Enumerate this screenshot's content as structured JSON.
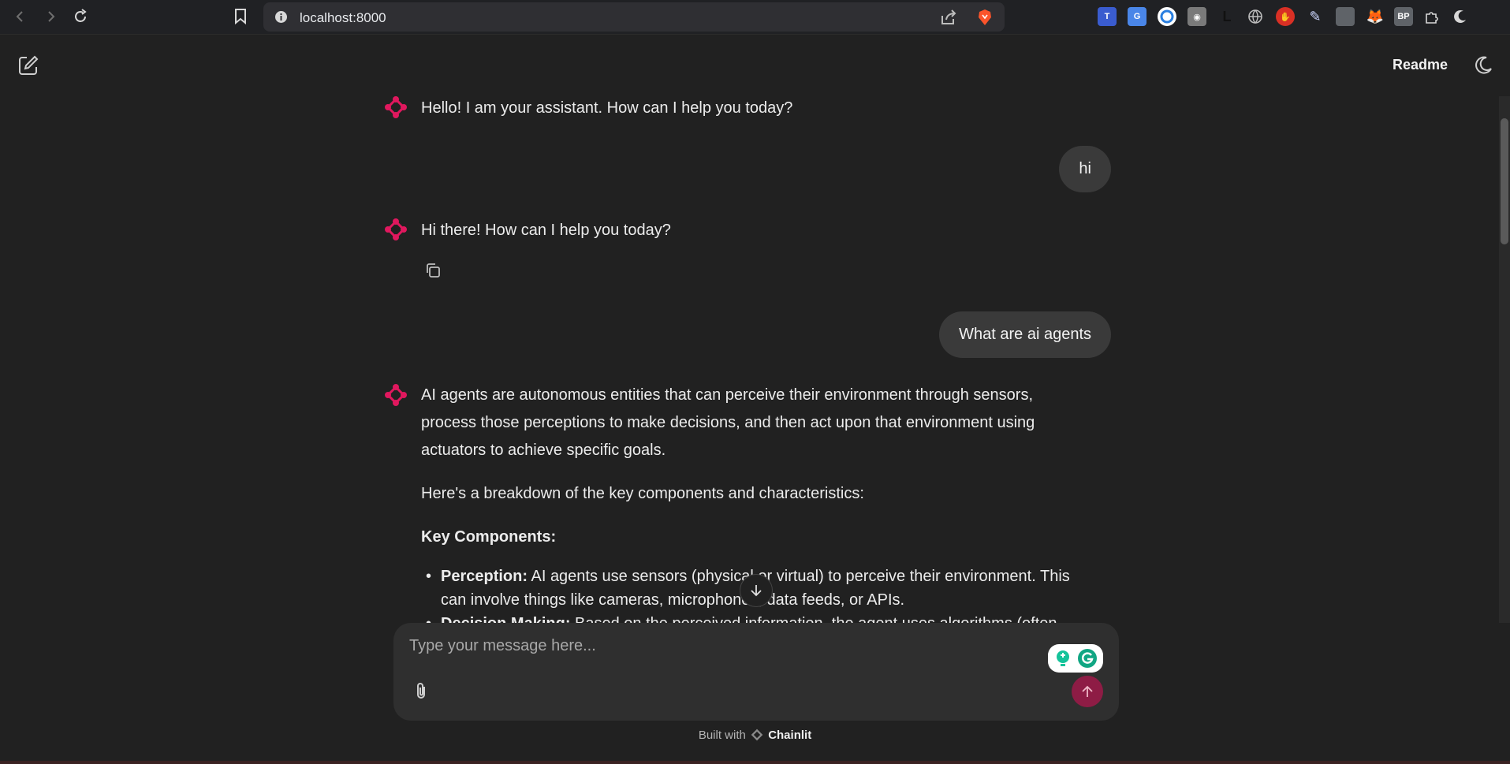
{
  "browser": {
    "url": "localhost:8000"
  },
  "header": {
    "readme_label": "Readme"
  },
  "messages": {
    "greeting": "Hello! I am your assistant. How can I help you today?",
    "user_1": "hi",
    "reply_1": "Hi there! How can I help you today?",
    "user_2": "What are ai agents",
    "reply_2_p1_l1": "AI agents are autonomous entities that can perceive their environment through sensors,",
    "reply_2_p1_l2": "process those perceptions to make decisions, and then act upon that environment using",
    "reply_2_p1_l3": "actuators to achieve specific goals.",
    "reply_2_p2": "Here's a breakdown of the key components and characteristics:",
    "reply_2_heading": "Key Components:",
    "bullet_1_term": "Perception:",
    "bullet_1_text": " AI agents use sensors (physical or virtual) to perceive their environment. This",
    "bullet_1_text_l2": "can involve things like cameras, microphones, data feeds, or APIs.",
    "bullet_2_term": "Decision Making:",
    "bullet_2_text": " Based on the perceived information, the agent uses algorithms (often"
  },
  "composer": {
    "placeholder": "Type your message here..."
  },
  "footer": {
    "built_with": "Built with",
    "brand": "Chainlit"
  },
  "colors": {
    "background": "#212121",
    "accent": "#e0185e",
    "send_button": "#8e1c45",
    "user_bubble": "#3a3a3a"
  },
  "icons": [
    "back-icon",
    "forward-icon",
    "reload-icon",
    "bookmark-icon",
    "info-icon",
    "share-icon",
    "brave-icon",
    "new-chat-icon",
    "moon-icon",
    "chainlit-logo-icon",
    "copy-icon",
    "arrow-down-icon",
    "paperclip-icon",
    "arrow-up-icon",
    "grammarly-icon"
  ]
}
